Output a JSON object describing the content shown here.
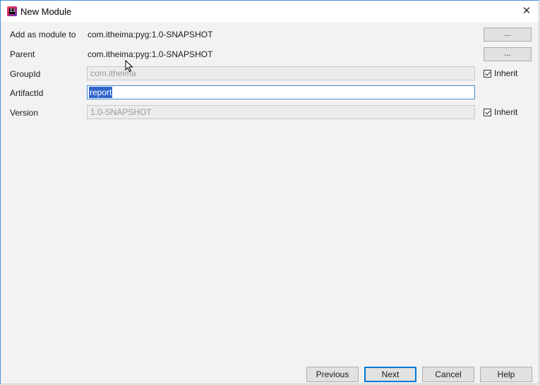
{
  "window": {
    "title": "New Module",
    "close_glyph": "✕"
  },
  "form": {
    "add_as_module_to": {
      "label": "Add as module to",
      "value": "com.itheima:pyg:1.0-SNAPSHOT",
      "browse_label": "..."
    },
    "parent": {
      "label": "Parent",
      "value": "com.itheima:pyg:1.0-SNAPSHOT",
      "browse_label": "..."
    },
    "group_id": {
      "label": "GroupId",
      "value": "com.itheima",
      "inherit_label": "Inherit",
      "inherit_checked": true
    },
    "artifact_id": {
      "label": "ArtifactId",
      "value": "report"
    },
    "version": {
      "label": "Version",
      "value": "1.0-SNAPSHOT",
      "inherit_label": "Inherit",
      "inherit_checked": true
    }
  },
  "footer": {
    "previous_label": "Previous",
    "next_label": "Next",
    "cancel_label": "Cancel",
    "help_label": "Help"
  },
  "colors": {
    "accent": "#0078d7",
    "selection": "#2f65ca",
    "window_border": "#4a90d9"
  },
  "icons": {
    "app": "intellij-idea-icon",
    "close": "close-icon",
    "checkbox": "checkmark-icon"
  }
}
